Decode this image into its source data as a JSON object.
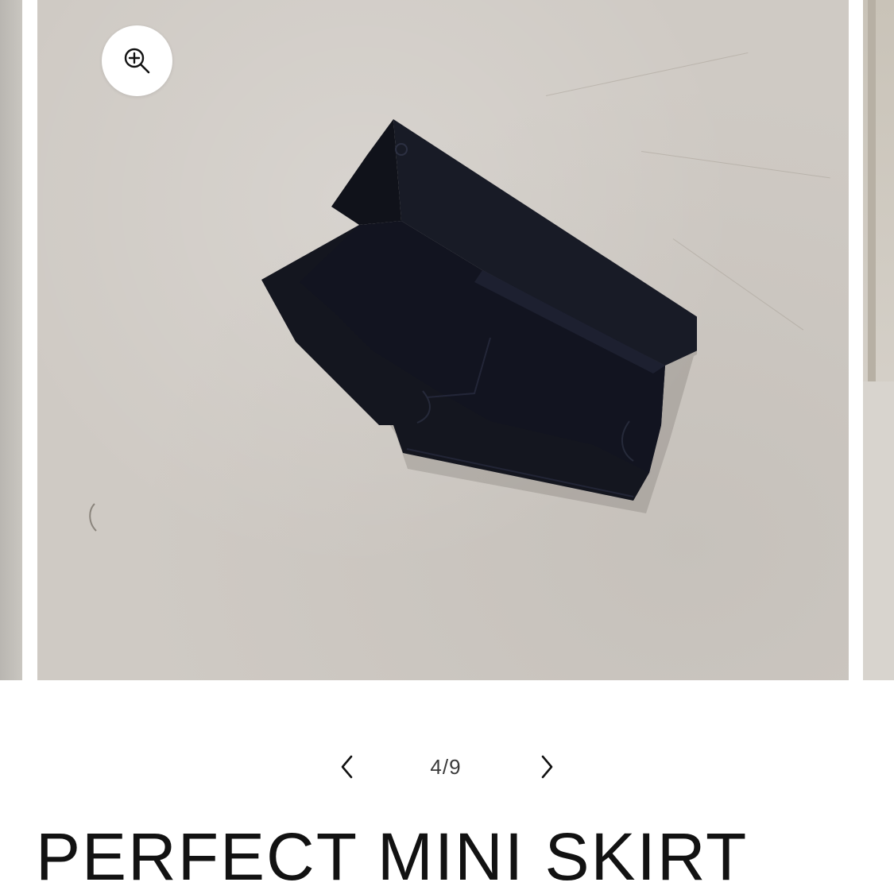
{
  "gallery": {
    "zoom_icon": "zoom-in-icon",
    "current_image_alt": "black skort on concrete floor"
  },
  "pagination": {
    "prev_icon": "chevron-left-icon",
    "next_icon": "chevron-right-icon",
    "counter": "4/9"
  },
  "product": {
    "title": "PERFECT MINI SKIRT"
  },
  "colors": {
    "background": "#ffffff",
    "text": "#121212",
    "fabric": "#12141f",
    "floor": "#cfcac4"
  }
}
